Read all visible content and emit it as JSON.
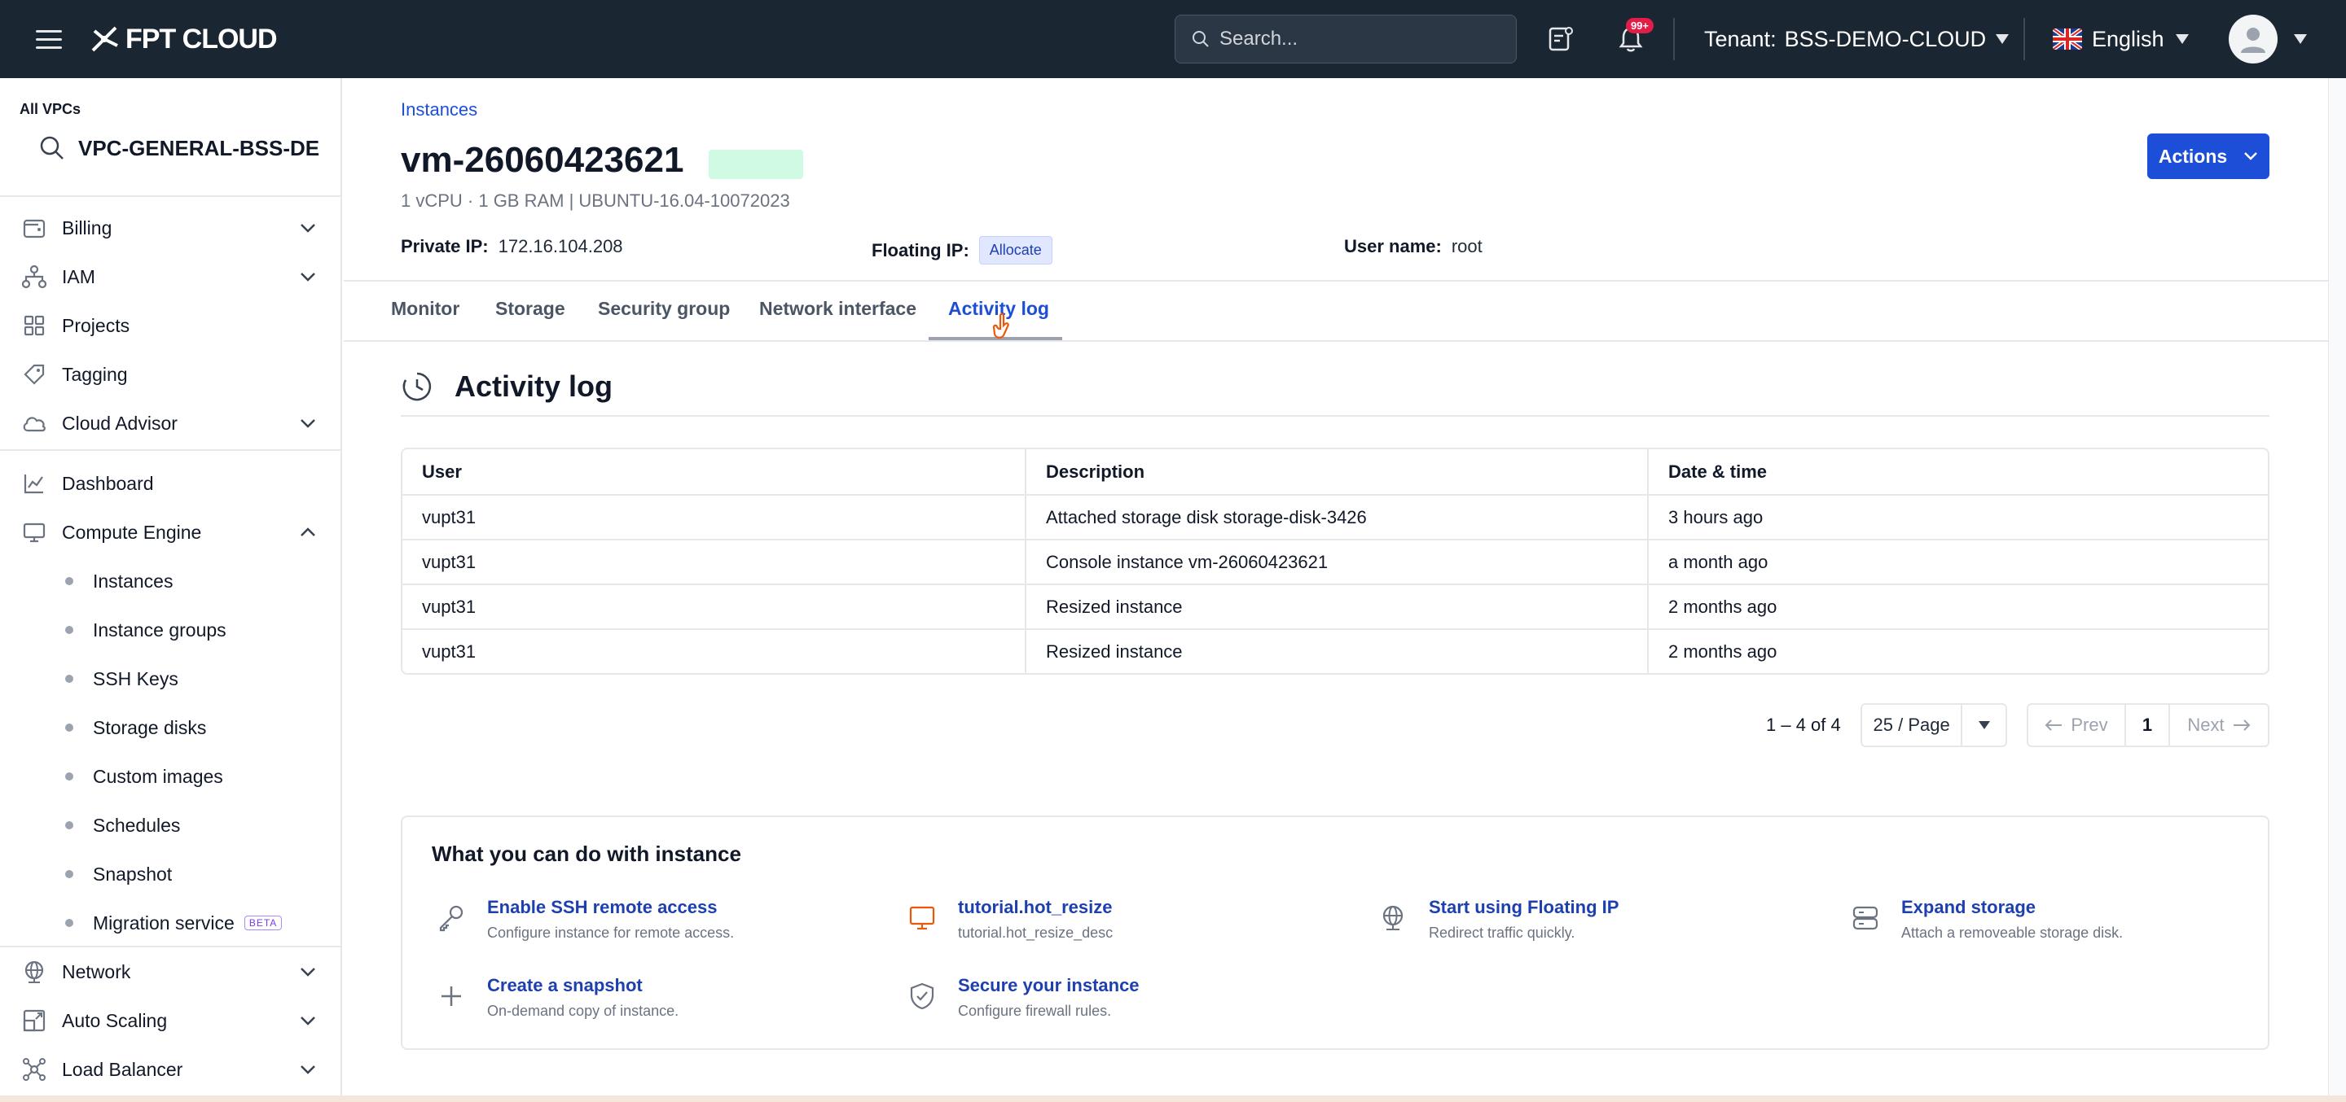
{
  "topbar": {
    "logo_text": "FPT CLOUD",
    "search_placeholder": "Search...",
    "notification_badge": "99+",
    "tenant_label": "Tenant:",
    "tenant_value": "BSS-DEMO-CLOUD",
    "language": "English"
  },
  "sidebar": {
    "vpc_label": "All VPCs",
    "vpc_selected": "VPC-GENERAL-BSS-DE",
    "items": [
      {
        "label": "Billing"
      },
      {
        "label": "IAM"
      },
      {
        "label": "Projects"
      },
      {
        "label": "Tagging"
      },
      {
        "label": "Cloud Advisor"
      },
      {
        "label": "Dashboard"
      },
      {
        "label": "Compute Engine"
      },
      {
        "label": "Network"
      },
      {
        "label": "Auto Scaling"
      },
      {
        "label": "Load Balancer"
      }
    ],
    "compute_sub": [
      {
        "label": "Instances"
      },
      {
        "label": "Instance groups"
      },
      {
        "label": "SSH Keys"
      },
      {
        "label": "Storage disks"
      },
      {
        "label": "Custom images"
      },
      {
        "label": "Schedules"
      },
      {
        "label": "Snapshot"
      },
      {
        "label": "Migration service"
      }
    ],
    "beta_label": "BETA"
  },
  "instance": {
    "breadcrumb": "Instances",
    "name": "vm-26060423621",
    "specs": "1 vCPU · 1 GB RAM | UBUNTU-16.04-10072023",
    "private_ip_label": "Private IP:",
    "private_ip": "172.16.104.208",
    "floating_ip_label": "Floating IP:",
    "allocate_label": "Allocate",
    "username_label": "User name:",
    "username": "root",
    "actions_label": "Actions"
  },
  "tabs": [
    {
      "label": "Monitor"
    },
    {
      "label": "Storage"
    },
    {
      "label": "Security group"
    },
    {
      "label": "Network interface"
    },
    {
      "label": "Activity log"
    }
  ],
  "activity": {
    "title": "Activity log",
    "columns": [
      "User",
      "Description",
      "Date & time"
    ],
    "rows": [
      {
        "user": "vupt31",
        "description": "Attached storage disk storage-disk-3426",
        "time": "3 hours ago"
      },
      {
        "user": "vupt31",
        "description": "Console instance vm-26060423621",
        "time": "a month ago"
      },
      {
        "user": "vupt31",
        "description": "Resized instance",
        "time": "2 months ago"
      },
      {
        "user": "vupt31",
        "description": "Resized instance",
        "time": "2 months ago"
      }
    ]
  },
  "pagination": {
    "range": "1 – 4 of 4",
    "page_size": "25 / Page",
    "prev": "Prev",
    "current": "1",
    "next": "Next"
  },
  "cando": {
    "title": "What you can do with instance",
    "items": [
      {
        "title": "Enable SSH remote access",
        "desc": "Configure instance for remote access.",
        "icon": "key-icon"
      },
      {
        "title": "tutorial.hot_resize",
        "desc": "tutorial.hot_resize_desc",
        "icon": "monitor-icon"
      },
      {
        "title": "Start using Floating IP",
        "desc": "Redirect traffic quickly.",
        "icon": "globe-icon"
      },
      {
        "title": "Expand storage",
        "desc": "Attach a removeable storage disk.",
        "icon": "storage-icon"
      },
      {
        "title": "Create a snapshot",
        "desc": "On-demand copy of instance.",
        "icon": "plus-icon"
      },
      {
        "title": "Secure your instance",
        "desc": "Configure firewall rules.",
        "icon": "shield-check-icon"
      }
    ]
  },
  "colors": {
    "topbar_bg": "#1b2633",
    "accent": "#1d4ed8",
    "status_pill": "#d1fae5",
    "notification_badge": "#e11d48"
  }
}
